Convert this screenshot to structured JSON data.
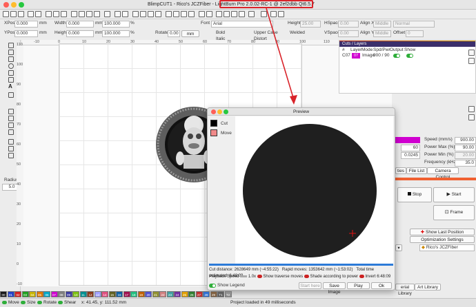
{
  "window": {
    "title_prefix": "BlimpCUT1 - Rico's JCZFiber",
    "title_highlight": "- LightBurn Pro 2.0.02-RC-1 @ 2ef2dbb Qt6.5.7"
  },
  "props": {
    "xpos_label": "XPos",
    "xpos": "0.000",
    "ypos_label": "YPos",
    "ypos": "0.000",
    "unit": "mm",
    "width_label": "Width",
    "width": "0.000",
    "height_label": "Height",
    "height": "0.000",
    "scale_w": "100.000",
    "scale_h": "100.000",
    "pct": "%",
    "rotate_label": "Rotate",
    "rotate": "0.00",
    "unit_btn": "mm",
    "font_label": "Font",
    "font": "Arial",
    "height2_label": "Height",
    "height2": "25.00",
    "bold": "Bold",
    "italic": "Italic",
    "upper_case": "Upper Case",
    "distort": "Distort",
    "welded": "Welded",
    "hspace_label": "HSpace",
    "hspace": "0.00",
    "vspace_label": "VSpace",
    "vspace": "0.00",
    "aligny_label": "Align Y",
    "aligny": "Middle",
    "alignx_label": "Align X",
    "alignx": "Middle",
    "normal": "Normal",
    "offset_label": "Offset",
    "offset": "0"
  },
  "tools": {
    "radius_label": "Radius:",
    "radius": "5.0"
  },
  "ruler_top": [
    "-10",
    "0",
    "10",
    "20",
    "30",
    "40",
    "50",
    "60",
    "70",
    "80",
    "90",
    "100",
    "110"
  ],
  "ruler_left": [
    "110",
    "100",
    "90",
    "80",
    "70",
    "60",
    "50",
    "40",
    "30",
    "20",
    "10",
    "0",
    "-10"
  ],
  "cuts": {
    "header": "Cuts / Layers",
    "cols": [
      "#",
      "Layer",
      "Mode",
      "Spd/Pwr",
      "Output",
      "Show"
    ],
    "row": {
      "num": "C07",
      "layer": "07",
      "mode": "Image",
      "spd": "900 / 90"
    }
  },
  "right": {
    "speed_label": "Speed (mm/s)",
    "speed": "900.00",
    "power_max_label": "Power Max (%)",
    "power_max": "90.00",
    "val60": "60",
    "power_min_label": "Power Min (%)",
    "power_min": "20.00",
    "val0245": "0.0245",
    "freq_label": "Frequency (kHz)",
    "freq": "35.0",
    "tab_ties": "ties",
    "tab_file_list": "File List",
    "tab_camera": "Camera Control",
    "stop": "Stop",
    "start": "Start",
    "frame": "Frame",
    "show_last_position": "Show Last Position",
    "optimization": "Optimization Settings",
    "device": "Rico's JCZFiber",
    "tab_art": "Art Library",
    "tab_material": "erial Library"
  },
  "preview": {
    "title": "Preview",
    "legend": [
      {
        "name": "Cut",
        "color": "#000000"
      },
      {
        "name": "Move",
        "color": "#f08a8a"
      }
    ],
    "cut_distance": "Cut distance: 2628649 mm (~4:55:22)",
    "rapid_moves": "Rapid moves: 1353642 mm (~1:53:02)",
    "total_time": "Total time estimated: 6:48:09",
    "playback_label": "Playback Speed",
    "playback": "1.0x",
    "show_rapid": "Show traverse moves",
    "shade": "Shade according to power",
    "invert": "Invert",
    "time_end": "6:48:09",
    "show_legend": "Show Legend",
    "start_here": "Start here",
    "save_image": "Save Image",
    "play": "Play",
    "ok": "Ok"
  },
  "status": {
    "move": "Move",
    "size": "Size",
    "rotate": "Rotate",
    "shear": "Shear",
    "coords": "x: 41.45, y: 111.52 mm",
    "message": "Project loaded in 49 milliseconds"
  },
  "palette": [
    {
      "l": "00",
      "c": "#1a1a1a"
    },
    {
      "l": "01",
      "c": "#2442c8"
    },
    {
      "l": "02",
      "c": "#d22020"
    },
    {
      "l": "03",
      "c": "#20a020"
    },
    {
      "l": "04",
      "c": "#c8b400"
    },
    {
      "l": "05",
      "c": "#e07800"
    },
    {
      "l": "06",
      "c": "#00a8c8"
    },
    {
      "l": "07",
      "c": "#d000d0"
    },
    {
      "l": "08",
      "c": "#808080"
    },
    {
      "l": "09",
      "c": "#3c3ca0"
    },
    {
      "l": "10",
      "c": "#7cc010"
    },
    {
      "l": "11",
      "c": "#009090"
    },
    {
      "l": "12",
      "c": "#8a3a1a"
    },
    {
      "l": "13",
      "c": "#a0a0ff"
    },
    {
      "l": "14",
      "c": "#e05080"
    },
    {
      "l": "15",
      "c": "#606020"
    },
    {
      "l": "16",
      "c": "#1060a0"
    },
    {
      "l": "17",
      "c": "#a01050"
    },
    {
      "l": "18",
      "c": "#20c080"
    },
    {
      "l": "19",
      "c": "#c06000"
    },
    {
      "l": "20",
      "c": "#5050d0"
    },
    {
      "l": "21",
      "c": "#909030"
    },
    {
      "l": "22",
      "c": "#d08080"
    },
    {
      "l": "23",
      "c": "#40a0a0"
    },
    {
      "l": "24",
      "c": "#7030a0"
    },
    {
      "l": "25",
      "c": "#e0a000"
    },
    {
      "l": "26",
      "c": "#308030"
    },
    {
      "l": "27",
      "c": "#c03030"
    },
    {
      "l": "28",
      "c": "#3070d0"
    },
    {
      "l": "29",
      "c": "#806040"
    },
    {
      "l": "T1",
      "c": "#606060"
    },
    {
      "l": "T2",
      "c": "#909090"
    }
  ]
}
